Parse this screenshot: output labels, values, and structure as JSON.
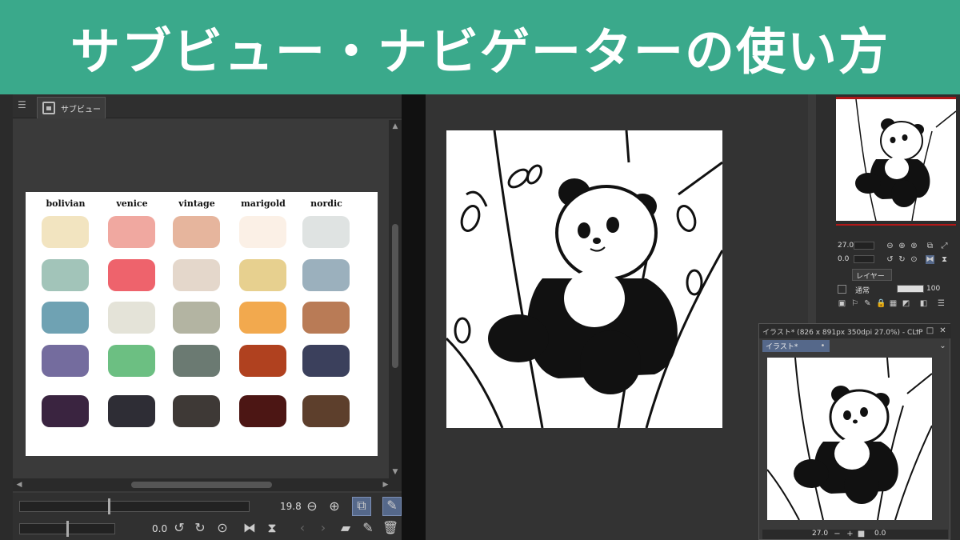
{
  "banner": {
    "title": "サブビュー・ナビゲーターの使い方"
  },
  "subview": {
    "tab_label": "サブビュー",
    "palettes": [
      {
        "name": "bolivian",
        "colors": [
          "#f2e4c0",
          "#a2c4b9",
          "#6fa2b3",
          "#746c9e",
          "#3a2440"
        ]
      },
      {
        "name": "venice",
        "colors": [
          "#f0a8a0",
          "#ee636c",
          "#e4e3d8",
          "#6cbf82",
          "#2e2d35"
        ]
      },
      {
        "name": "vintage",
        "colors": [
          "#e6b59d",
          "#e4d7cb",
          "#b3b4a2",
          "#6b7a72",
          "#3e3936"
        ]
      },
      {
        "name": "marigold",
        "colors": [
          "#fbf0e6",
          "#e7d08f",
          "#f2a94e",
          "#b0411f",
          "#4c1614"
        ]
      },
      {
        "name": "nordic",
        "colors": [
          "#dfe3e2",
          "#9bb0bd",
          "#b97b56",
          "#3b405c",
          "#5d3f2c"
        ]
      }
    ],
    "zoom_value": "19.8",
    "rotate_value": "0.0"
  },
  "navigator": {
    "zoom_value": "27.0",
    "rotate_value": "0.0",
    "layer_tab": "レイヤー",
    "blend_mode": "通常",
    "opacity": "100"
  },
  "float_window": {
    "title": "イラスト* (826 x 891px 350dpi 27.0%) - CLIP",
    "tab_label": "イラスト*",
    "zoom_value": "27.0",
    "rotate_value": "0.0"
  },
  "colors": {
    "banner": "#3aa98b",
    "active_button": "#55688a"
  }
}
